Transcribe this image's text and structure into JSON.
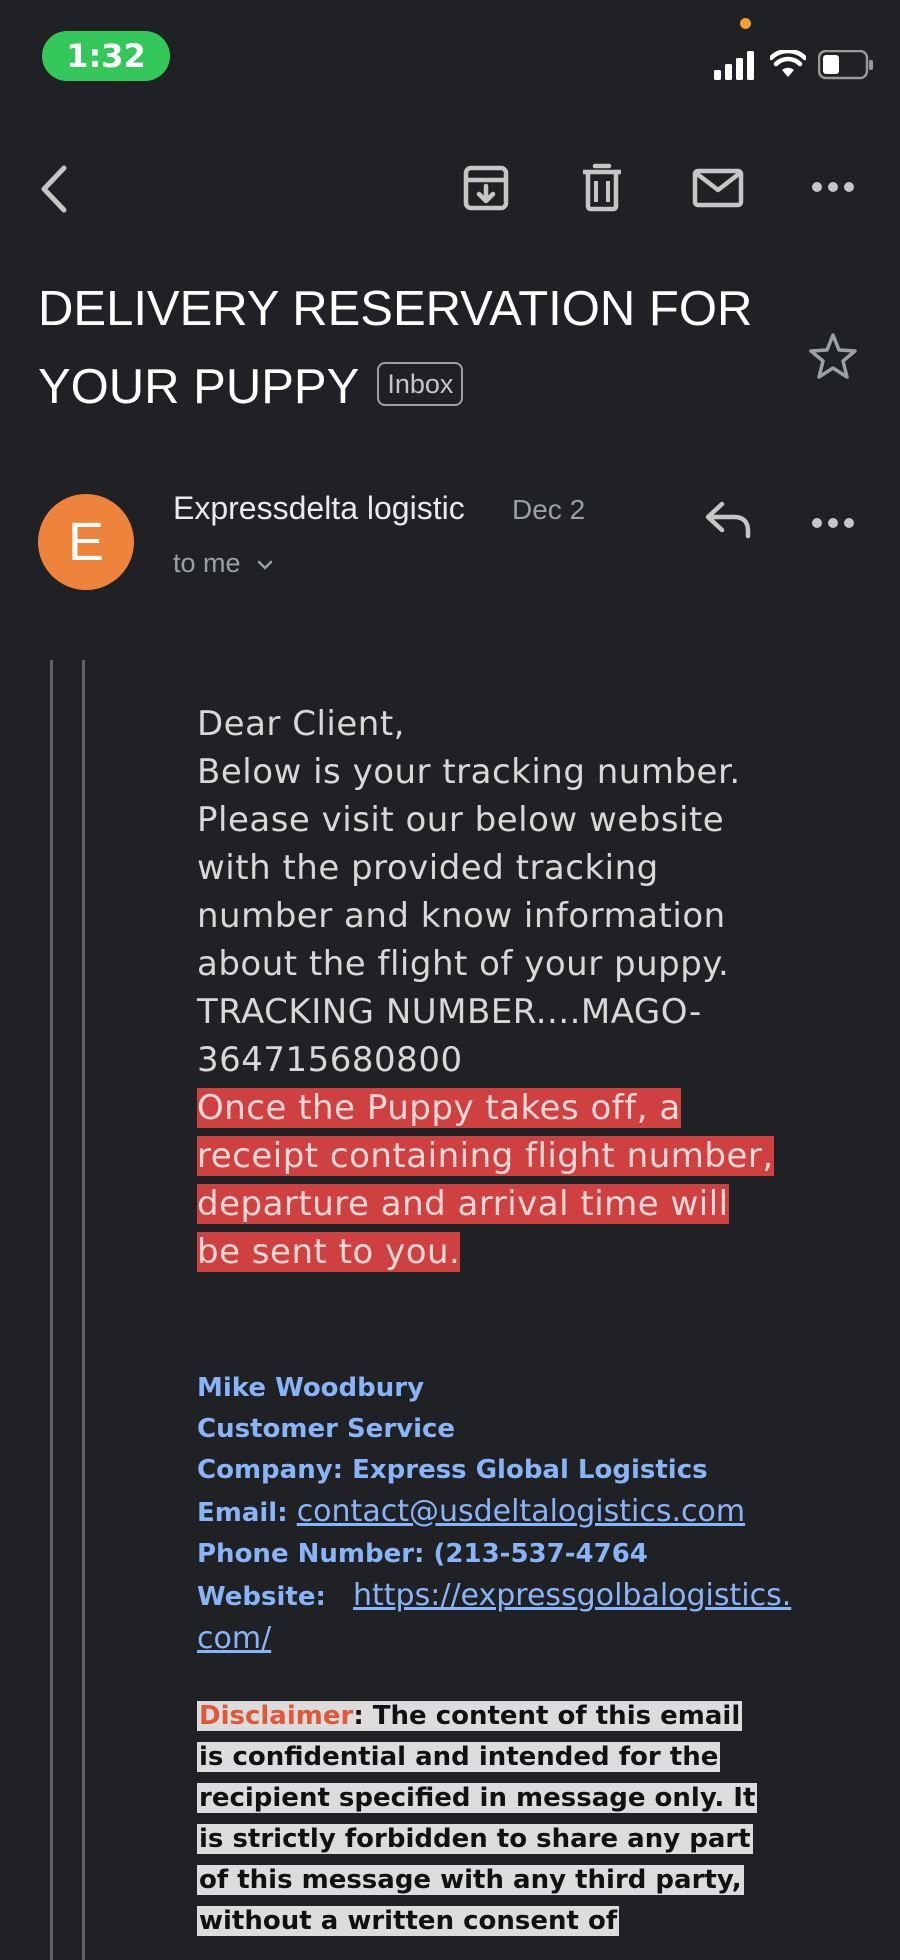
{
  "status_bar": {
    "time": "1:32"
  },
  "email": {
    "subject": "DELIVERY RESERVATION FOR YOUR PUPPY",
    "label": "Inbox",
    "sender_initial": "E",
    "sender_name": "Expressdelta logistic",
    "date": "Dec 2",
    "recipient": "to me",
    "body": {
      "greeting": "Dear Client,",
      "paragraph": "Below is your tracking number. Please visit our below website with the provided tracking number and know information about the flight of your puppy.",
      "tracking": "TRACKING NUMBER....MAGO-364715680800",
      "highlight": "Once the Puppy takes off, a receipt containing flight number, departure and arrival time will be sent to you."
    },
    "signature": {
      "name": "Mike Woodbury",
      "role": "Customer Service",
      "company": "Company: Express Global Logistics",
      "email_label": "Email:",
      "email_value": "contact@usdeltalogistics.com",
      "phone": "Phone Number: (213-537-4764",
      "website_label": "Website:",
      "website_value": "https://expressgolbalogistics.com/"
    },
    "disclaimer": {
      "label": "Disclaimer",
      "text": ": The content of this email is confidential and intended for the recipient specified in message only. It is strictly forbidden to share any part of this message with any third party, without a written consent of"
    }
  },
  "colors": {
    "background": "#202124",
    "avatar": "#ee843c",
    "highlight": "#cf4040",
    "link": "#8ab4f8",
    "time_pill": "#34c759"
  },
  "icons": [
    "back-icon",
    "archive-icon",
    "trash-icon",
    "mail-icon",
    "more-icon",
    "star-icon",
    "reply-icon",
    "chevron-down-icon",
    "signal-icon",
    "wifi-icon",
    "battery-icon"
  ]
}
